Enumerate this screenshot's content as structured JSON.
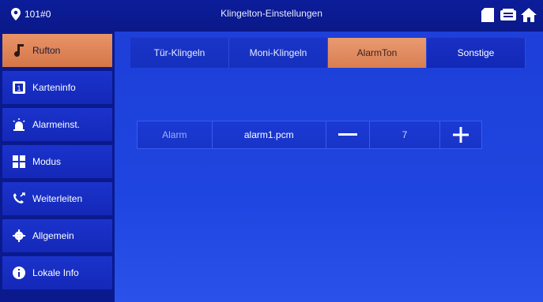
{
  "header": {
    "room": "101#0",
    "title": "Klingelton-Einstellungen"
  },
  "sidebar": {
    "items": [
      {
        "label": "Rufton",
        "icon": "music-note-icon",
        "active": true
      },
      {
        "label": "Karteninfo",
        "icon": "card-icon",
        "active": false
      },
      {
        "label": "Alarmeinst.",
        "icon": "alarm-light-icon",
        "active": false
      },
      {
        "label": "Modus",
        "icon": "grid-icon",
        "active": false
      },
      {
        "label": "Weiterleiten",
        "icon": "phone-forward-icon",
        "active": false
      },
      {
        "label": "Allgemein",
        "icon": "gear-icon",
        "active": false
      },
      {
        "label": "Lokale Info",
        "icon": "info-icon",
        "active": false
      }
    ]
  },
  "tabs": [
    {
      "label": "Tür-Klingeln",
      "active": false
    },
    {
      "label": "Moni-Klingeln",
      "active": false
    },
    {
      "label": "AlarmTon",
      "active": true
    },
    {
      "label": "Sonstige",
      "active": false
    }
  ],
  "alarm_row": {
    "label": "Alarm",
    "file": "alarm1.pcm",
    "volume": "7"
  },
  "colors": {
    "accent": "#e0845a",
    "background": "#1f45e0",
    "sidebar": "#1428b8"
  }
}
